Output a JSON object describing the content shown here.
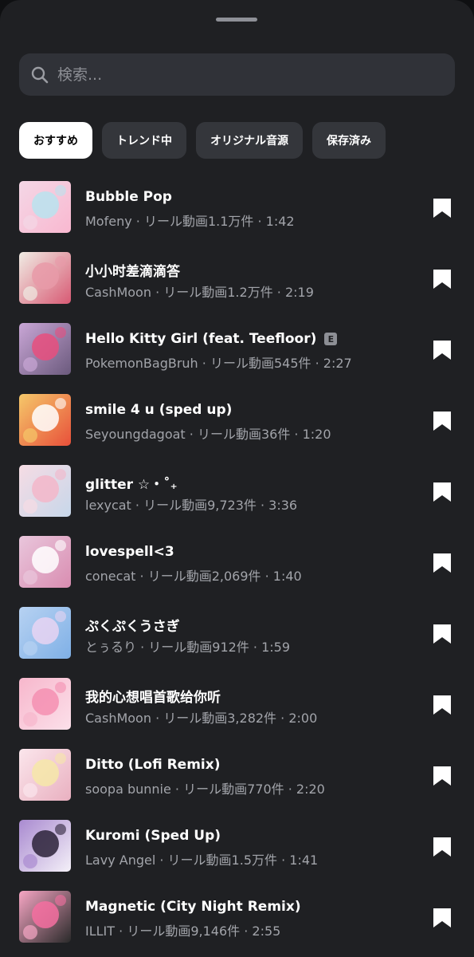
{
  "search": {
    "placeholder": "検索..."
  },
  "tabs": [
    {
      "label": "おすすめ",
      "active": true
    },
    {
      "label": "トレンド中",
      "active": false
    },
    {
      "label": "オリジナル音源",
      "active": false
    },
    {
      "label": "保存済み",
      "active": false
    }
  ],
  "tracks": [
    {
      "title": "Bubble Pop",
      "explicit": false,
      "artist": "Mofeny",
      "reels": "リール動画1.1万件",
      "duration": "1:42",
      "cover": [
        "#f4d7e6",
        "#b9e3ef",
        "#f9b8d0"
      ]
    },
    {
      "title": "小小时差滴滴答",
      "explicit": false,
      "artist": "CashMoon",
      "reels": "リール動画1.2万件",
      "duration": "2:19",
      "cover": [
        "#f0ece4",
        "#e79aa8",
        "#d85a74"
      ]
    },
    {
      "title": "Hello Kitty Girl (feat. Teefloor)",
      "explicit": true,
      "explicit_label": "E",
      "artist": "PokemonBagBruh",
      "reels": "リール動画545件",
      "duration": "2:27",
      "cover": [
        "#c9a6d6",
        "#e84f7e",
        "#6b5a7d"
      ]
    },
    {
      "title": "smile 4 u (sped up)",
      "explicit": false,
      "artist": "Seyoungdagoat",
      "reels": "リール動画36件",
      "duration": "1:20",
      "cover": [
        "#f5c86a",
        "#ffffff",
        "#e8503a"
      ]
    },
    {
      "title": "glitter ☆・˚₊",
      "explicit": false,
      "artist": "lexycat",
      "reels": "リール動画9,723件",
      "duration": "3:36",
      "cover": [
        "#f6dce4",
        "#f3b6c9",
        "#c7d7ea"
      ]
    },
    {
      "title": "lovespell<3",
      "explicit": false,
      "artist": "conecat",
      "reels": "リール動画2,069件",
      "duration": "1:40",
      "cover": [
        "#e9c6dc",
        "#ffffff",
        "#d98db1"
      ]
    },
    {
      "title": "ぷくぷくうさぎ",
      "explicit": false,
      "artist": "とぅるり",
      "reels": "リール動画912件",
      "duration": "1:59",
      "cover": [
        "#b7d2f2",
        "#e8d3f2",
        "#7fb0e6"
      ]
    },
    {
      "title": "我的心想唱首歌给你听",
      "explicit": false,
      "artist": "CashMoon",
      "reels": "リール動画3,282件",
      "duration": "2:00",
      "cover": [
        "#f7b7cc",
        "#f48fb1",
        "#fce0ea"
      ]
    },
    {
      "title": "Ditto (Lofi Remix)",
      "explicit": false,
      "artist": "soopa bunnie",
      "reels": "リール動画770件",
      "duration": "2:20",
      "cover": [
        "#fbe6ec",
        "#f6e7a8",
        "#e9b0c0"
      ]
    },
    {
      "title": "Kuromi (Sped Up)",
      "explicit": false,
      "artist": "Lavy Angel",
      "reels": "リール動画1.5万件",
      "duration": "1:41",
      "cover": [
        "#a98ad0",
        "#2b2238",
        "#f4f0f8"
      ]
    },
    {
      "title": "Magnetic (City Night Remix)",
      "explicit": false,
      "artist": "ILLIT",
      "reels": "リール動画9,146件",
      "duration": "2:55",
      "cover": [
        "#f7a6c4",
        "#f46fa0",
        "#2a2a2a"
      ]
    }
  ],
  "colors": {
    "sheet": "#1f2023",
    "search_bg": "#303238",
    "chip_bg": "#34363b",
    "chip_active_bg": "#ffffff",
    "meta_text": "#a2a4aa"
  },
  "icons": {
    "search": "search-icon",
    "bookmark": "bookmark-icon"
  }
}
